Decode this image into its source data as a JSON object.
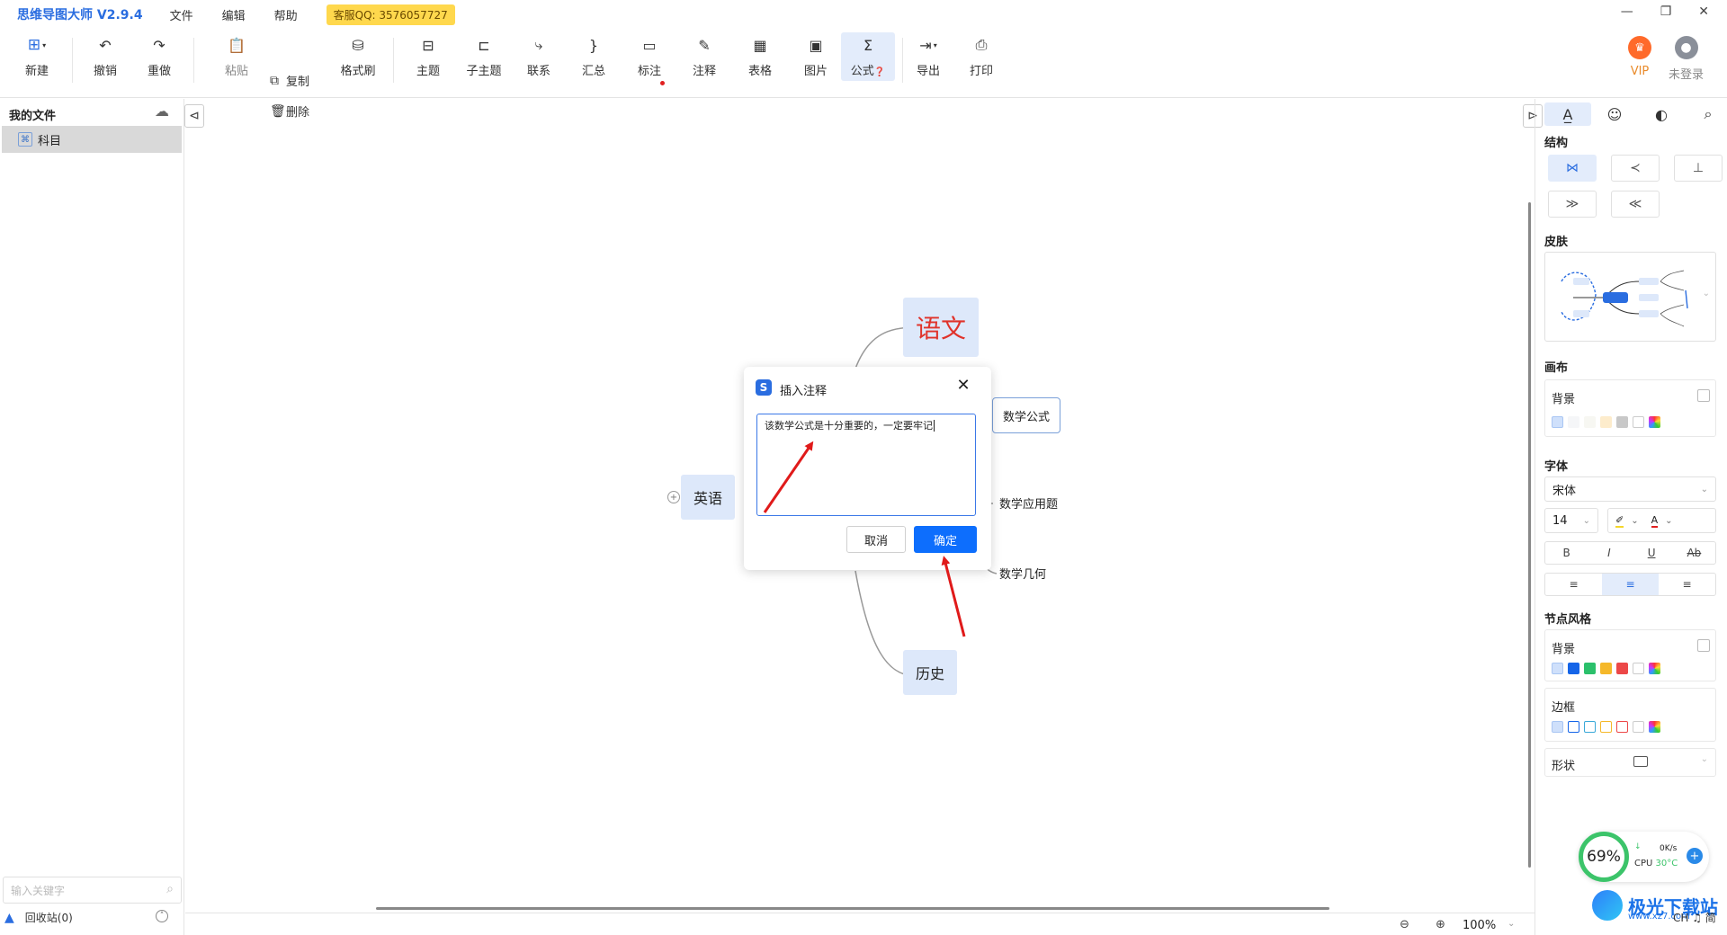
{
  "titlebar": {
    "app_title": "思维导图大师 V2.9.4",
    "menus": [
      "文件",
      "编辑",
      "帮助"
    ],
    "service": "客服QQ: 3576057727"
  },
  "toolbar": {
    "new": "新建",
    "undo": "撤销",
    "redo": "重做",
    "paste": "粘贴",
    "copy": "复制",
    "delete": "删除",
    "format_brush": "格式刷",
    "topic": "主题",
    "subtopic": "子主题",
    "relation": "联系",
    "summary": "汇总",
    "mark": "标注",
    "note": "注释",
    "table": "表格",
    "image": "图片",
    "formula": "公式",
    "export": "导出",
    "print": "打印",
    "vip": "VIP",
    "login": "未登录"
  },
  "left_panel": {
    "title": "我的文件",
    "files": [
      "科目"
    ],
    "search_placeholder": "输入关键字",
    "recycle": "回收站(0)"
  },
  "mindmap": {
    "nodes": {
      "yuwen": "语文",
      "yingyu": "英语",
      "lishi": "历史",
      "shuxuegongshi": "数学公式",
      "shuxueyingyongti": "数学应用题",
      "shuxuejihe": "数学几何"
    }
  },
  "dialog": {
    "title": "插入注释",
    "text": "该数学公式是十分重要的，一定要牢记",
    "cancel": "取消",
    "ok": "确定"
  },
  "right_panel": {
    "structure": "结构",
    "skin": "皮肤",
    "canvas": "画布",
    "canvas_bg": "背景",
    "font": "字体",
    "font_family": "宋体",
    "font_size": "14",
    "node_style": "节点风格",
    "node_bg": "背景",
    "border": "边框",
    "shape": "形状",
    "colors": {
      "canvas_bg": [
        "#f5f6f8",
        "#f7f7f2",
        "#fdeccc",
        "#c8c8c8"
      ],
      "node_bg": [
        "#1565e8",
        "#2bc06b",
        "#f5b82a",
        "#ec4848"
      ],
      "border": [
        "#1565e8",
        "#3aa9d8",
        "#f5b82a",
        "#ec4848"
      ]
    }
  },
  "statusbar": {
    "zoom": "100%"
  },
  "widgets": {
    "cpu_percent": "69%",
    "net_speed": "0K/s",
    "cpu_label": "CPU",
    "cpu_temp": "30°C",
    "watermark": "极光下载站",
    "watermark_sub": "www.xz7.com",
    "ime": "CH ♫ 简"
  }
}
